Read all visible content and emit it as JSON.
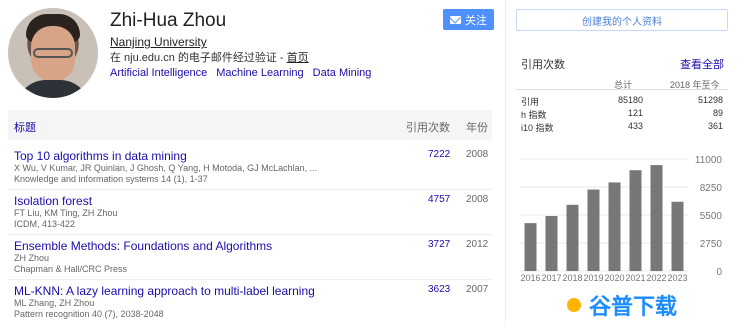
{
  "profile": {
    "name": "Zhi-Hua Zhou",
    "affiliation": "Nanjing University",
    "verified": "在 nju.edu.cn 的电子邮件经过验证 - ",
    "homepage_link": "首页",
    "interests": [
      "Artificial Intelligence",
      "Machine Learning",
      "Data Mining"
    ]
  },
  "buttons": {
    "follow": "关注",
    "create_profile": "创建我的个人资料"
  },
  "table_header": {
    "title": "标题",
    "citations": "引用次数",
    "year": "年份"
  },
  "publications": [
    {
      "title": "Top 10 algorithms in data mining",
      "authors": "X Wu, V Kumar, JR Quinlan, J Ghosh, Q Yang, H Motoda, GJ McLachlan, ...",
      "venue": "Knowledge and information systems 14 (1), 1-37",
      "citations": "7222",
      "year": "2008"
    },
    {
      "title": "Isolation forest",
      "authors": "FT Liu, KM Ting, ZH Zhou",
      "venue": "ICDM, 413-422",
      "citations": "4757",
      "year": "2008"
    },
    {
      "title": "Ensemble Methods: Foundations and Algorithms",
      "authors": "ZH Zhou",
      "venue": "Chapman & Hall/CRC Press",
      "citations": "3727",
      "year": "2012"
    },
    {
      "title": "ML-KNN: A lazy learning approach to multi-label learning",
      "authors": "ML Zhang, ZH Zhou",
      "venue": "Pattern recognition 40 (7), 2038-2048",
      "citations": "3623",
      "year": "2007"
    }
  ],
  "stats": {
    "title": "引用次数",
    "view_all": "查看全部",
    "col_all": "总计",
    "col_since": "2018 年至今",
    "rows": [
      {
        "label": "引用",
        "all": "85180",
        "since": "51298"
      },
      {
        "label": "h 指数",
        "all": "121",
        "since": "89"
      },
      {
        "label": "i10 指数",
        "all": "433",
        "since": "361"
      }
    ]
  },
  "chart_data": {
    "type": "bar",
    "categories": [
      "2016",
      "2017",
      "2018",
      "2019",
      "2020",
      "2021",
      "2022",
      "2023"
    ],
    "values": [
      4700,
      5400,
      6500,
      8000,
      8700,
      9900,
      10400,
      6800
    ],
    "yticks": [
      "11000",
      "8250",
      "5500",
      "2750",
      "0"
    ],
    "ylim": [
      0,
      11000
    ],
    "bar_color": "#777777"
  },
  "watermark": "谷普下载",
  "colors": {
    "link": "#1a0dab",
    "accent": "#4d90fe"
  }
}
